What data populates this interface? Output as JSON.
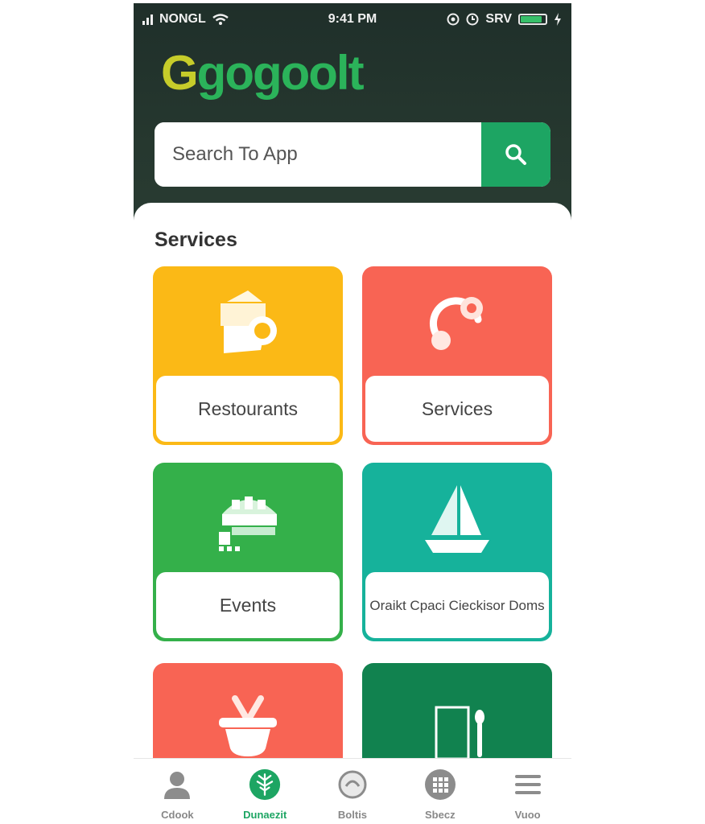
{
  "status_bar": {
    "carrier": "NONGL",
    "time": "9:41 PM",
    "network": "SRV",
    "battery_level": 0.85
  },
  "logo": {
    "first_letter": "G",
    "rest": "gogoolt"
  },
  "search": {
    "placeholder": "Search To App"
  },
  "section": {
    "title": "Services"
  },
  "cards": [
    {
      "label": "Restourants",
      "color": "#fbb916",
      "icon": "takeout-bag-icon"
    },
    {
      "label": "Services",
      "color": "#f86454",
      "icon": "service-ring-icon"
    },
    {
      "label": "Events",
      "color": "#34b04a",
      "icon": "events-building-icon"
    },
    {
      "label": "Oraikt Cpaci Cieckisor Doms",
      "color": "#16b29b",
      "icon": "sailboat-icon"
    },
    {
      "label": "",
      "color": "#f86454",
      "icon": "basket-icon"
    },
    {
      "label": "",
      "color": "#11824f",
      "icon": "menu-cutlery-icon"
    }
  ],
  "tabs": [
    {
      "label": "Cdook",
      "icon": "person-icon",
      "active": false
    },
    {
      "label": "Dunaezit",
      "icon": "tree-icon",
      "active": true
    },
    {
      "label": "Boltis",
      "icon": "chat-icon",
      "active": false
    },
    {
      "label": "Sbecz",
      "icon": "grid-icon",
      "active": false
    },
    {
      "label": "Vuoo",
      "icon": "menu-icon",
      "active": false
    }
  ],
  "colors": {
    "accent": "#1da563",
    "header_bg": "#26382f"
  }
}
